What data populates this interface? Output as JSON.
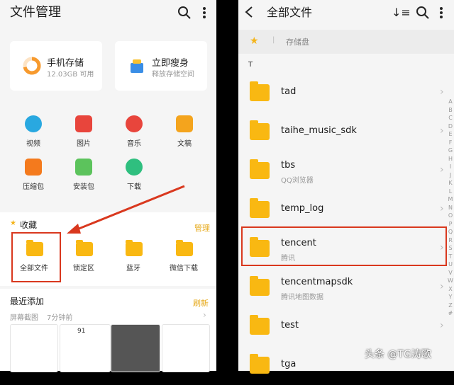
{
  "left": {
    "title": "文件管理",
    "cards": [
      {
        "title": "手机存储",
        "sub": "12.03GB 可用",
        "icon": "storage-ring-icon"
      },
      {
        "title": "立即瘦身",
        "sub": "释放存储空间",
        "icon": "cleanup-icon"
      }
    ],
    "categories": [
      {
        "label": "视频",
        "icon": "video-icon",
        "color": "#29a8e0"
      },
      {
        "label": "图片",
        "icon": "image-icon",
        "color": "#e8453c"
      },
      {
        "label": "音乐",
        "icon": "music-icon",
        "color": "#e8453c"
      },
      {
        "label": "文稿",
        "icon": "document-icon",
        "color": "#f4a41d"
      },
      {
        "label": "压缩包",
        "icon": "archive-icon",
        "color": "#f47a1d"
      },
      {
        "label": "安装包",
        "icon": "android-icon",
        "color": "#5cc35c"
      },
      {
        "label": "下载",
        "icon": "download-icon",
        "color": "#2fbf7f"
      }
    ],
    "favorites": {
      "title": "收藏",
      "action": "管理",
      "items": [
        "全部文件",
        "锁定区",
        "蓝牙",
        "微信下载"
      ]
    },
    "recent": {
      "title": "最近添加",
      "action": "刷新",
      "source": "屏幕截图",
      "time": "7分钟前",
      "thumb_value": "91"
    }
  },
  "right": {
    "title": "全部文件",
    "breadcrumb": "存储盘",
    "section": "T",
    "folders": [
      {
        "name": "tad",
        "sub": ""
      },
      {
        "name": "taihe_music_sdk",
        "sub": ""
      },
      {
        "name": "tbs",
        "sub": "QQ浏览器"
      },
      {
        "name": "temp_log",
        "sub": ""
      },
      {
        "name": "tencent",
        "sub": "腾讯"
      },
      {
        "name": "tencentmapsdk",
        "sub": "腾讯地图数据"
      },
      {
        "name": "test",
        "sub": ""
      },
      {
        "name": "tga",
        "sub": ""
      }
    ],
    "alphabet": [
      "A",
      "B",
      "C",
      "D",
      "E",
      "F",
      "G",
      "H",
      "I",
      "J",
      "K",
      "L",
      "M",
      "N",
      "O",
      "P",
      "Q",
      "R",
      "S",
      "T",
      "U",
      "V",
      "W",
      "X",
      "Y",
      "Z",
      "#"
    ]
  },
  "watermark": "头条 @TG涛歌",
  "colors": {
    "accent": "#e6a817",
    "folder": "#f9b812",
    "highlight": "#d9381e"
  }
}
